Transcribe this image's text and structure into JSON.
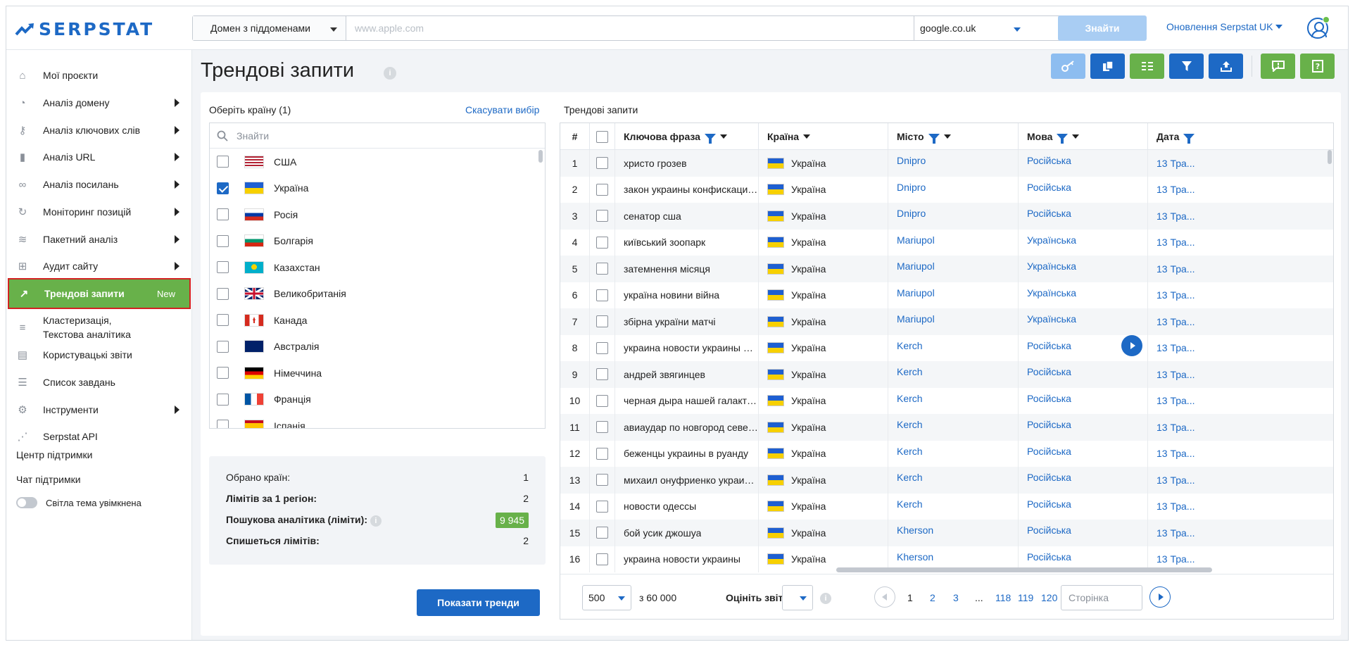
{
  "header": {
    "logo_text": "SERPSTAT",
    "domain_mode": "Домен з піддоменами",
    "search_placeholder": "www.apple.com",
    "engine": "google.co.uk",
    "find_label": "Знайти",
    "updates_label": "Оновлення Serpstat",
    "lang": "UK"
  },
  "sidebar": {
    "items": [
      {
        "label": "Мої проєкти",
        "icon": "home-icon",
        "arrow": false
      },
      {
        "label": "Аналіз домену",
        "icon": "domain-analysis-icon",
        "arrow": true
      },
      {
        "label": "Аналіз ключових слів",
        "icon": "key-icon",
        "arrow": true
      },
      {
        "label": "Аналіз URL",
        "icon": "bar-chart-icon",
        "arrow": true
      },
      {
        "label": "Аналіз посилань",
        "icon": "link-icon",
        "arrow": true
      },
      {
        "label": "Моніторинг позицій",
        "icon": "history-icon",
        "arrow": true
      },
      {
        "label": "Пакетний аналіз",
        "icon": "database-icon",
        "arrow": true
      },
      {
        "label": "Аудит сайту",
        "icon": "sitemap-icon",
        "arrow": true
      },
      {
        "label": "Трендові запити",
        "icon": "trend-icon",
        "arrow": false,
        "badge": "New"
      },
      {
        "label": "Кластеризація, Текстова аналітика",
        "icon": "cluster-icon",
        "arrow": false
      },
      {
        "label": "Користувацькі звіти",
        "icon": "report-icon",
        "arrow": false
      },
      {
        "label": "Список завдань",
        "icon": "list-icon",
        "arrow": false
      },
      {
        "label": "Інструменти",
        "icon": "gear-icon",
        "arrow": true
      },
      {
        "label": "Serpstat API",
        "icon": "api-icon",
        "arrow": false
      }
    ],
    "support_center": "Центр підтримки",
    "support_chat": "Чат підтримки",
    "theme_label": "Світла тема увімкнена"
  },
  "page": {
    "title": "Трендові запити"
  },
  "country_panel": {
    "label": "Оберіть країну (1)",
    "cancel": "Скасувати вибір",
    "search_placeholder": "Знайти",
    "countries": [
      {
        "name": "США",
        "checked": false,
        "flag": "us"
      },
      {
        "name": "Україна",
        "checked": true,
        "flag": "ua"
      },
      {
        "name": "Росія",
        "checked": false,
        "flag": "ru"
      },
      {
        "name": "Болгарія",
        "checked": false,
        "flag": "bg"
      },
      {
        "name": "Казахстан",
        "checked": false,
        "flag": "kz"
      },
      {
        "name": "Великобританія",
        "checked": false,
        "flag": "gb"
      },
      {
        "name": "Канада",
        "checked": false,
        "flag": "ca"
      },
      {
        "name": "Австралія",
        "checked": false,
        "flag": "au"
      },
      {
        "name": "Німеччина",
        "checked": false,
        "flag": "de"
      },
      {
        "name": "Франція",
        "checked": false,
        "flag": "fr"
      },
      {
        "name": "Іспанія",
        "checked": false,
        "flag": "es"
      }
    ]
  },
  "stats": {
    "selected_label": "Обрано країн:",
    "selected_value": "1",
    "limit_label": "Лімітів за 1 регіон:",
    "limit_value": "2",
    "analytics_label": "Пошукова аналітика (ліміти):",
    "analytics_value": "9 945",
    "spend_label": "Спишеться лімітів:",
    "spend_value": "2"
  },
  "show_button": "Показати тренди",
  "table": {
    "title": "Трендові запити",
    "headers": {
      "num": "#",
      "keyword": "Ключова фраза",
      "country": "Країна",
      "city": "Місто",
      "language": "Мова",
      "date": "Дата"
    },
    "rows": [
      {
        "n": "1",
        "kw": "христо грозев",
        "country": "Україна",
        "city": "Dnipro",
        "lang": "Російська",
        "date": "13 Тра..."
      },
      {
        "n": "2",
        "kw": "закон украины конфискации имущества",
        "country": "Україна",
        "city": "Dnipro",
        "lang": "Російська",
        "date": "13 Тра..."
      },
      {
        "n": "3",
        "kw": "сенатор сша",
        "country": "Україна",
        "city": "Dnipro",
        "lang": "Російська",
        "date": "13 Тра..."
      },
      {
        "n": "4",
        "kw": "київський зоопарк",
        "country": "Україна",
        "city": "Mariupol",
        "lang": "Українська",
        "date": "13 Тра..."
      },
      {
        "n": "5",
        "kw": "затемнення місяця",
        "country": "Україна",
        "city": "Mariupol",
        "lang": "Українська",
        "date": "13 Тра..."
      },
      {
        "n": "6",
        "kw": "україна новини війна",
        "country": "Україна",
        "city": "Mariupol",
        "lang": "Українська",
        "date": "13 Тра..."
      },
      {
        "n": "7",
        "kw": "збірна україни матчі",
        "country": "Україна",
        "city": "Mariupol",
        "lang": "Українська",
        "date": "13 Тра..."
      },
      {
        "n": "8",
        "kw": "украина новости украины война",
        "country": "Україна",
        "city": "Kerch",
        "lang": "Російська",
        "date": "13 Тра..."
      },
      {
        "n": "9",
        "kw": "андрей звягинцев",
        "country": "Україна",
        "city": "Kerch",
        "lang": "Російська",
        "date": "13 Тра..."
      },
      {
        "n": "10",
        "kw": "черная дыра нашей галактики",
        "country": "Україна",
        "city": "Kerch",
        "lang": "Російська",
        "date": "13 Тра..."
      },
      {
        "n": "11",
        "kw": "авиаудар по новгород северский",
        "country": "Україна",
        "city": "Kerch",
        "lang": "Російська",
        "date": "13 Тра..."
      },
      {
        "n": "12",
        "kw": "беженцы украины в руанду",
        "country": "Україна",
        "city": "Kerch",
        "lang": "Російська",
        "date": "13 Тра..."
      },
      {
        "n": "13",
        "kw": "михаил онуфриенко украинский",
        "country": "Україна",
        "city": "Kerch",
        "lang": "Російська",
        "date": "13 Тра..."
      },
      {
        "n": "14",
        "kw": "новости одессы",
        "country": "Україна",
        "city": "Kerch",
        "lang": "Російська",
        "date": "13 Тра..."
      },
      {
        "n": "15",
        "kw": "бой усик джошуа",
        "country": "Україна",
        "city": "Kherson",
        "lang": "Російська",
        "date": "13 Тра..."
      },
      {
        "n": "16",
        "kw": "украина новости украины",
        "country": "Україна",
        "city": "Kherson",
        "lang": "Російська",
        "date": "13 Тра..."
      }
    ]
  },
  "pager": {
    "per_page": "500",
    "total": "з 60 000",
    "rate_label": "Оцініть звіт",
    "pages": [
      "1",
      "2",
      "3",
      "...",
      "118",
      "119",
      "120"
    ],
    "page_placeholder": "Сторінка"
  },
  "colors": {
    "primary": "#1d69c5",
    "green": "#68b14a",
    "active_outline": "#d32222"
  }
}
